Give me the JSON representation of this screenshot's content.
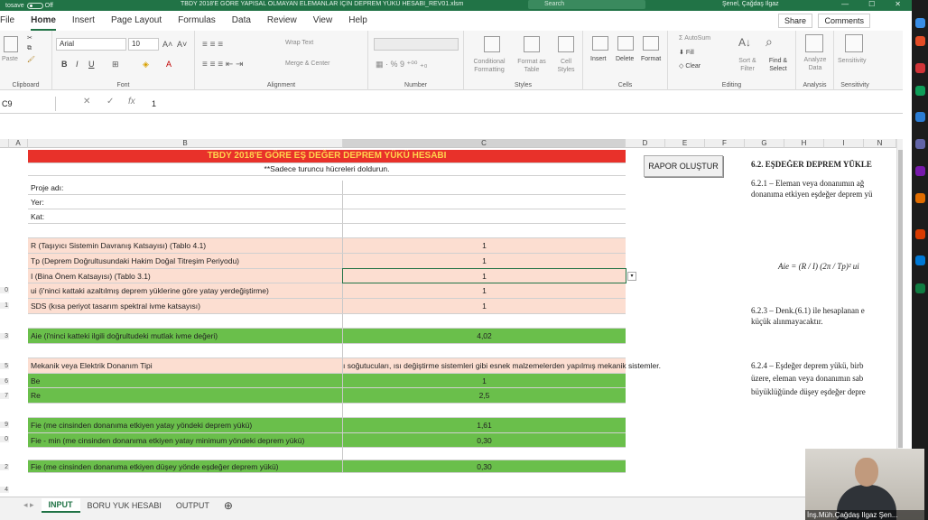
{
  "window": {
    "title": "TBDY 2018'E GÖRE YAPISAL OLMAYAN ELEMANLAR İÇİN DEPREM YÜKÜ HESABI_REV01.xlsm",
    "autosave_label": "tosave",
    "autosave_state": "Off",
    "search_placeholder": "Search",
    "user": "Şenel, Çağdaş Ilgaz",
    "buttons": [
      "—",
      "☐",
      "✕"
    ]
  },
  "ribbon_tabs": [
    "File",
    "Home",
    "Insert",
    "Page Layout",
    "Formulas",
    "Data",
    "Review",
    "View",
    "Help"
  ],
  "active_tab": "Home",
  "share_label": "Share",
  "comments_label": "Comments",
  "ribbon": {
    "clipboard": {
      "label": "Clipboard",
      "paste": "Paste"
    },
    "font": {
      "label": "Font",
      "font_name": "Arial",
      "font_size": "10"
    },
    "alignment": {
      "label": "Alignment",
      "wrap": "Wrap Text",
      "merge": "Merge & Center"
    },
    "number": {
      "label": "Number",
      "format": ""
    },
    "styles": {
      "label": "Styles",
      "conditional": "Conditional Formatting",
      "format_table": "Format as Table",
      "cell_styles": "Cell Styles"
    },
    "cells": {
      "label": "Cells",
      "insert": "Insert",
      "delete": "Delete",
      "format": "Format"
    },
    "editing": {
      "label": "Editing",
      "autosum": "AutoSum",
      "fill": "Fill",
      "clear": "Clear",
      "sort": "Sort & Filter",
      "find": "Find & Select"
    },
    "analysis": {
      "label": "Analysis",
      "analyze": "Analyze Data"
    },
    "sensitivity": {
      "label": "Sensitivity",
      "btn": "Sensitivity"
    }
  },
  "formula_bar": {
    "name_box": "C9",
    "value": "1"
  },
  "columns": [
    "A",
    "B",
    "C",
    "D",
    "E",
    "F",
    "G",
    "H",
    "I",
    "N"
  ],
  "rows": {
    "title": "TBDY 2018'E GÖRE EŞ DEĞER DEPREM YÜKÜ HESABI",
    "note": "**Sadece turuncu hücreleri doldurun.",
    "proje": "Proje adı:",
    "yer": "Yer:",
    "kat": "Kat:",
    "r_label": "R (Taşıyıcı Sistemin Davranış Katsayısı) (Tablo 4.1)",
    "r_value": "1",
    "tp_label": "Tp (Deprem Doğrultusundaki Hakim Doğal Titreşim Periyodu)",
    "tp_value": "1",
    "i_label": "I (Bina Önem Katsayısı) (Tablo 3.1)",
    "i_value": "1",
    "ui_label": "ui (i'ninci kattaki azaltılmış deprem yüklerine göre yatay yerdeğiştirme)",
    "ui_value": "1",
    "sds_label": "SDS (kısa periyot tasarım spektral ivme katsayısı)",
    "sds_value": "1",
    "aie_label": "Aie (i'ninci katteki ilgili doğrultudeki mutlak ivme değeri)",
    "aie_value": "4,02",
    "mek_label": "Mekanik veya Elektrik Donanım Tipi",
    "mek_value": "ı soğutucuları, ısı değiştirme sistemleri gibi esnek malzemelerden yapılmış mekanik sistemler.",
    "be_label": "Be",
    "be_value": "1",
    "re_label": "Re",
    "re_value": "2,5",
    "fie_label": "Fie (me cinsinden donanıma etkiyen yatay yöndeki deprem yükü)",
    "fie_value": "1,61",
    "fiemin_label": "Fie - min (me cinsinden donanıma etkiyen yatay minimum yöndeki deprem yükü)",
    "fiemin_value": "0,30",
    "fiev_label": "Fie (me cinsinden donanıma etkiyen düşey yönde eşdeğer deprem yükü)",
    "fiev_value": "0,30"
  },
  "row_numbers": [
    "",
    "",
    "",
    "",
    "",
    "",
    "",
    "",
    "",
    "",
    "0",
    "1",
    "",
    "3",
    "",
    "5",
    "6",
    "7",
    "",
    "9",
    "0",
    "",
    "2",
    "",
    "4"
  ],
  "rapor_button": "RAPOR OLUŞTUR",
  "doc": {
    "heading": "6.2. EŞDEĞER DEPREM YÜKLE",
    "p1a": "6.2.1 – Eleman veya donanımın ağ",
    "p1b": "donanıma etkiyen eşdeğer deprem yü",
    "formula": "Aie = (R / I) (2π / Tp)² ui",
    "p2a": "6.2.3 – Denk.(6.1) ile hesaplanan e",
    "p2b": "küçük alınmayacaktır.",
    "p3a": "6.2.4 – Eşdeğer deprem yükü, birb",
    "p3b": "üzere, eleman veya donanımın sab",
    "p3c": "büyüklüğünde düşey eşdeğer depre"
  },
  "sheets": [
    "INPUT",
    "BORU YUK HESABI",
    "OUTPUT"
  ],
  "active_sheet": "INPUT",
  "webcam_name": "İnş.Müh.Çağdaş Ilgaz Şen...",
  "colors": {
    "excel_green": "#217346",
    "title_red": "#e8312a",
    "pink": "#fcded1",
    "green": "#6abf4b"
  }
}
